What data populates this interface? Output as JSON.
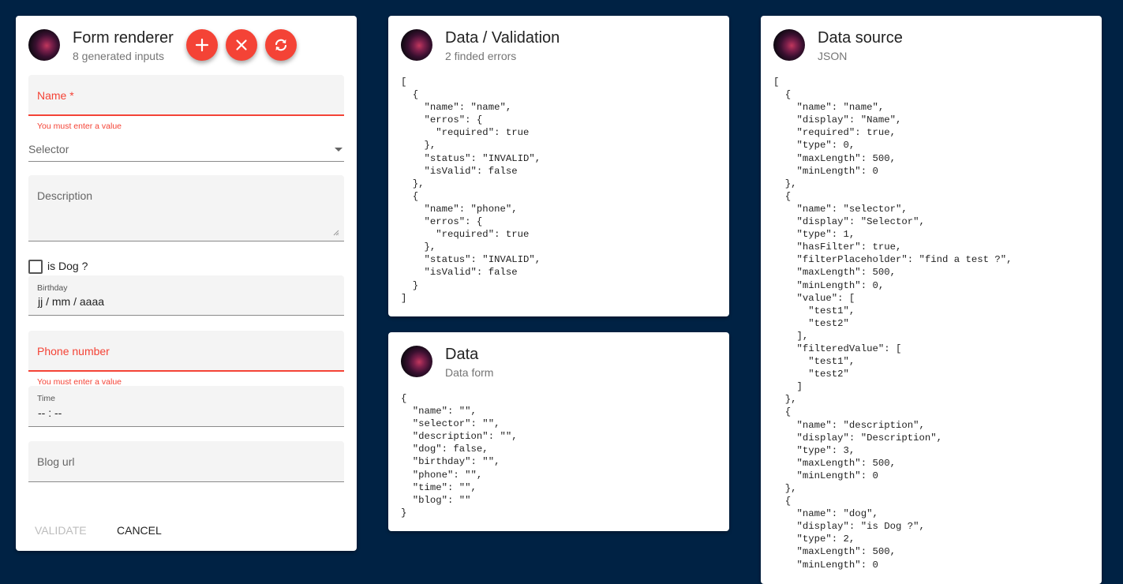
{
  "form_card": {
    "title": "Form renderer",
    "subtitle": "8 generated inputs",
    "fab_add_icon": "plus-icon",
    "fab_clear_icon": "close-icon",
    "fab_refresh_icon": "refresh-icon",
    "name_label": "Name *",
    "name_error": "You must enter a value",
    "selector_label": "Selector",
    "description_label": "Description",
    "dog_label": "is Dog ?",
    "birthday_label": "Birthday",
    "birthday_placeholder": "jj / mm / aaaa",
    "phone_label": "Phone number",
    "phone_error": "You must enter a value",
    "time_label": "Time",
    "time_placeholder": "-- : --",
    "blog_label": "Blog url",
    "validate_label": "VALIDATE",
    "cancel_label": "CANCEL"
  },
  "validation_card": {
    "title": "Data / Validation",
    "subtitle": "2 finded errors",
    "json": "[\n  {\n    \"name\": \"name\",\n    \"erros\": {\n      \"required\": true\n    },\n    \"status\": \"INVALID\",\n    \"isValid\": false\n  },\n  {\n    \"name\": \"phone\",\n    \"erros\": {\n      \"required\": true\n    },\n    \"status\": \"INVALID\",\n    \"isValid\": false\n  }\n]"
  },
  "data_card": {
    "title": "Data",
    "subtitle": "Data form",
    "json": "{\n  \"name\": \"\",\n  \"selector\": \"\",\n  \"description\": \"\",\n  \"dog\": false,\n  \"birthday\": \"\",\n  \"phone\": \"\",\n  \"time\": \"\",\n  \"blog\": \"\"\n}"
  },
  "source_card": {
    "title": "Data source",
    "subtitle": "JSON",
    "json": "[\n  {\n    \"name\": \"name\",\n    \"display\": \"Name\",\n    \"required\": true,\n    \"type\": 0,\n    \"maxLength\": 500,\n    \"minLength\": 0\n  },\n  {\n    \"name\": \"selector\",\n    \"display\": \"Selector\",\n    \"type\": 1,\n    \"hasFilter\": true,\n    \"filterPlaceholder\": \"find a test ?\",\n    \"maxLength\": 500,\n    \"minLength\": 0,\n    \"value\": [\n      \"test1\",\n      \"test2\"\n    ],\n    \"filteredValue\": [\n      \"test1\",\n      \"test2\"\n    ]\n  },\n  {\n    \"name\": \"description\",\n    \"display\": \"Description\",\n    \"type\": 3,\n    \"maxLength\": 500,\n    \"minLength\": 0\n  },\n  {\n    \"name\": \"dog\",\n    \"display\": \"is Dog ?\",\n    \"type\": 2,\n    \"maxLength\": 500,\n    \"minLength\": 0"
  },
  "colors": {
    "background": "#002244",
    "accent": "#f44336",
    "card": "#ffffff",
    "field_fill": "#f4f4f4"
  }
}
